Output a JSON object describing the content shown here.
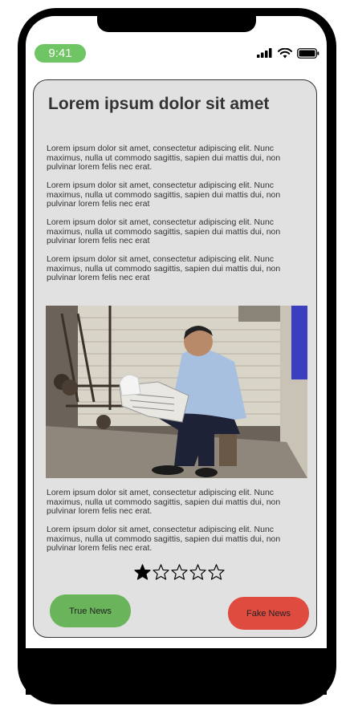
{
  "status_bar": {
    "time": "9:41",
    "icons": [
      "signal-icon",
      "wifi-icon",
      "battery-icon"
    ]
  },
  "article": {
    "title": "Lorem ipsum dolor sit amet",
    "paragraphs_top": [
      "Lorem ipsum dolor sit amet, consectetur adipiscing elit. Nunc maximus, nulla ut commodo sagittis, sapien dui mattis dui, non pulvinar lorem felis nec erat.",
      "Lorem ipsum dolor sit amet, consectetur adipiscing elit. Nunc maximus, nulla ut commodo sagittis, sapien dui mattis dui, non pulvinar lorem felis nec erat",
      "Lorem ipsum dolor sit amet, consectetur adipiscing elit. Nunc maximus, nulla ut commodo sagittis, sapien dui mattis dui, non pulvinar lorem felis nec erat",
      "Lorem ipsum dolor sit amet, consectetur adipiscing elit. Nunc maximus, nulla ut commodo sagittis, sapien dui mattis dui, non pulvinar lorem felis nec erat"
    ],
    "paragraphs_bottom": [
      "Lorem ipsum dolor sit amet, consectetur adipiscing elit. Nunc maximus, nulla ut commodo sagittis, sapien dui mattis dui, non pulvinar lorem felis nec erat.",
      "Lorem ipsum dolor sit amet, consectetur adipiscing elit. Nunc maximus, nulla ut commodo sagittis, sapien dui mattis dui, non pulvinar lorem felis nec erat."
    ],
    "photo_icon": "photo-man-reading-newspaper"
  },
  "rating": {
    "value": 1,
    "max": 5
  },
  "actions": {
    "true_label": "True News",
    "fake_label": "Fake News"
  },
  "colors": {
    "time_pill": "#6fc463",
    "true_button": "#6ab55b",
    "fake_button": "#e04b3f",
    "card_bg": "#e1e1e1"
  }
}
